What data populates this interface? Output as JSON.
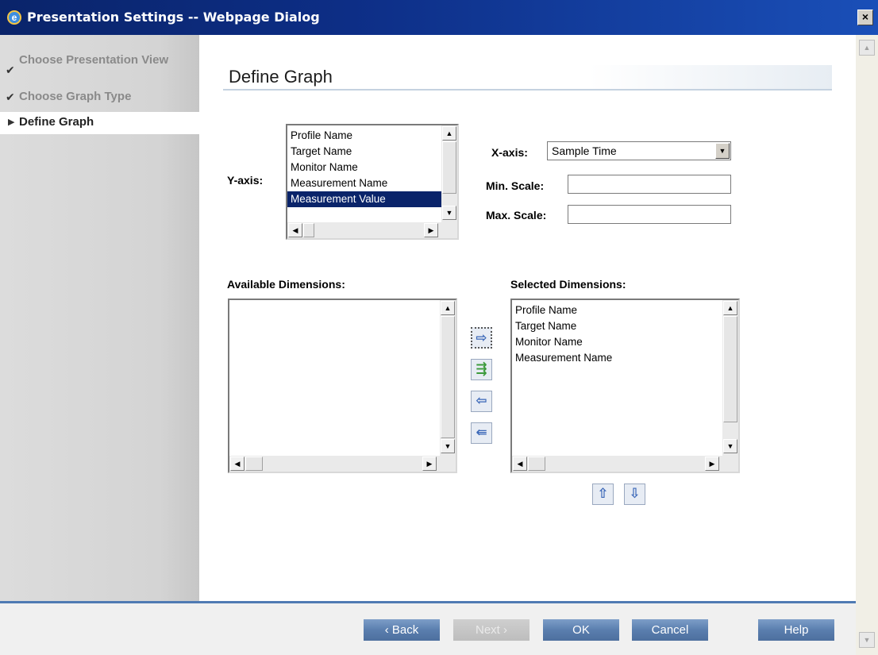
{
  "window": {
    "title": "Presentation Settings -- Webpage Dialog",
    "close": "×"
  },
  "sidebar": {
    "steps": [
      {
        "label": "Choose Presentation View",
        "state": "done",
        "mark": "✔"
      },
      {
        "label": "Choose Graph Type",
        "state": "done",
        "mark": "✔"
      },
      {
        "label": "Define Graph",
        "state": "current",
        "mark": "▶"
      }
    ]
  },
  "main": {
    "heading": "Define Graph",
    "yaxis": {
      "label": "Y-axis:",
      "items": [
        "Profile Name",
        "Target Name",
        "Monitor Name",
        "Measurement Name",
        "Measurement Value"
      ],
      "selected_index": 4
    },
    "xaxis": {
      "label": "X-axis:",
      "value": "Sample Time"
    },
    "min_scale": {
      "label": "Min. Scale:",
      "value": ""
    },
    "max_scale": {
      "label": "Max. Scale:",
      "value": ""
    },
    "available": {
      "label": "Available Dimensions:",
      "items": []
    },
    "selected": {
      "label": "Selected Dimensions:",
      "items": [
        "Profile Name",
        "Target Name",
        "Monitor Name",
        "Measurement Name"
      ]
    }
  },
  "footer": {
    "back": "‹ Back",
    "next": "Next ›",
    "ok": "OK",
    "cancel": "Cancel",
    "help": "Help"
  }
}
